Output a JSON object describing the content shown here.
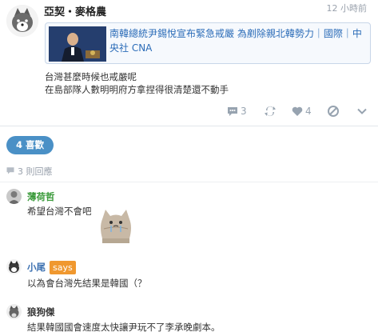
{
  "post": {
    "author": "亞契・麥格農",
    "time": "12 小時前",
    "link_title": "南韓總統尹錫悅宣布緊急戒嚴 為剷除親北韓勢力｜國際｜中央社 CNA",
    "text_lines": [
      "台灣甚麼時候也戒嚴呢",
      "在島部隊人數明明府方拿捏得很清楚還不動手"
    ],
    "actions": {
      "comment_count": "3",
      "repost_label": "",
      "like_count": "4"
    }
  },
  "likes_label": "4 喜歡",
  "reply_count_label": "3 則回應",
  "comments": [
    {
      "name": "薄荷哲",
      "name_color": "#3a9a3a",
      "text": "希望台灣不會吧"
    },
    {
      "name": "小尾",
      "name_color": "#3a6fb0",
      "badge": "says",
      "text": "以為會台灣先結果是韓國（？"
    },
    {
      "name": "狼狗傑",
      "name_color": "#333333",
      "text": "結果韓國國會速度太快讓尹玩不了李承晚劇本。"
    }
  ],
  "colors": {
    "accent": "#4a90c6",
    "link": "#2b6cb8",
    "badge": "#f0982f"
  }
}
